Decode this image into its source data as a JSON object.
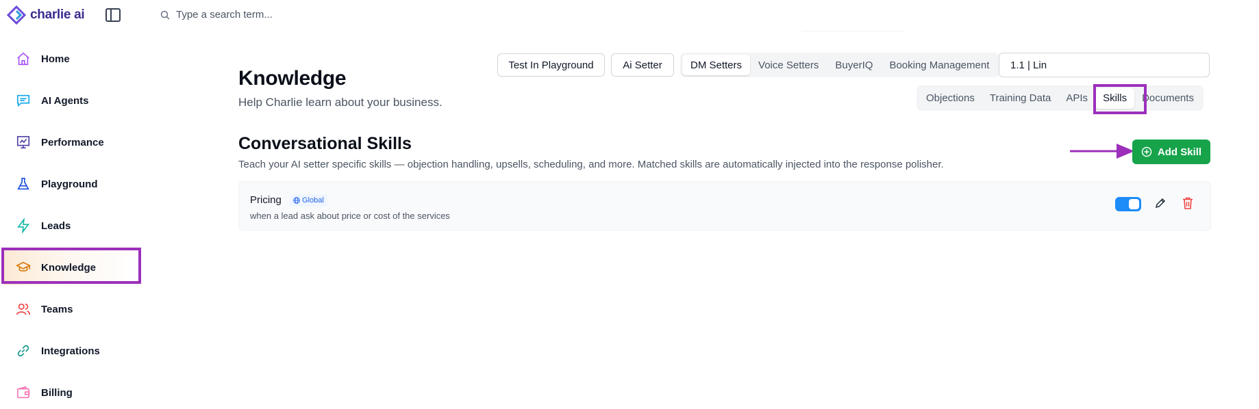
{
  "app": {
    "logo_text": "charlie ai"
  },
  "search": {
    "placeholder": "Type a search term..."
  },
  "sidebar": {
    "items": [
      {
        "label": "Home",
        "icon": "home-icon"
      },
      {
        "label": "AI Agents",
        "icon": "chat-icon"
      },
      {
        "label": "Performance",
        "icon": "chart-icon"
      },
      {
        "label": "Playground",
        "icon": "flask-icon"
      },
      {
        "label": "Leads",
        "icon": "bolt-icon"
      },
      {
        "label": "Knowledge",
        "icon": "graduation-cap-icon",
        "active": true
      },
      {
        "label": "Teams",
        "icon": "users-icon"
      },
      {
        "label": "Integrations",
        "icon": "link-icon"
      },
      {
        "label": "Billing",
        "icon": "wallet-icon"
      }
    ]
  },
  "header": {
    "title": "Knowledge",
    "subtitle": "Help Charlie learn about your business.",
    "test_playground_label": "Test In Playground",
    "ai_setter_label": "Ai Setter",
    "setter_tabs": [
      "DM Setters",
      "Voice Setters",
      "BuyerIQ",
      "Booking Management"
    ],
    "setter_tab_active": "DM Setters",
    "agent_select_value": "1.1 | Lin",
    "knowledge_tabs": [
      "Objections",
      "Training Data",
      "APIs",
      "Skills",
      "Documents"
    ],
    "knowledge_tab_active": "Skills"
  },
  "section": {
    "title": "Conversational Skills",
    "description": "Teach your AI setter specific skills — objection handling, upsells, scheduling, and more. Matched skills are automatically injected into the response polisher.",
    "add_button_label": "Add Skill"
  },
  "skills": [
    {
      "name": "Pricing",
      "badge": "Global",
      "description": "when a lead ask about price or cost of the services",
      "enabled": true
    }
  ],
  "colors": {
    "accent_green": "#16a34a",
    "annotation_purple": "#9c2fbb",
    "toggle_blue": "#1d8cf8",
    "delete_red": "#ef4444"
  }
}
